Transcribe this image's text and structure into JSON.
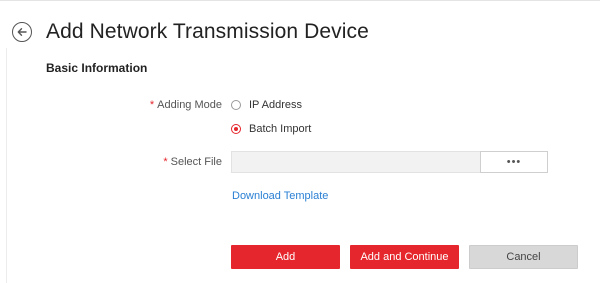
{
  "header": {
    "title": "Add Network Transmission Device",
    "back_icon": "arrow-left-circle-icon"
  },
  "section": {
    "title": "Basic Information"
  },
  "form": {
    "adding_mode": {
      "required_mark": "*",
      "label": "Adding Mode",
      "options": [
        {
          "label": "IP Address",
          "selected": false
        },
        {
          "label": "Batch Import",
          "selected": true
        }
      ]
    },
    "select_file": {
      "required_mark": "*",
      "label": "Select File",
      "value": "",
      "browse_label": "•••"
    },
    "download_template_link": "Download Template"
  },
  "actions": {
    "add_label": "Add",
    "add_continue_label": "Add and Continue",
    "cancel_label": "Cancel"
  },
  "colors": {
    "accent": "#e5262c",
    "link": "#2a7fd4",
    "cancel_bg": "#d8d8d8"
  }
}
